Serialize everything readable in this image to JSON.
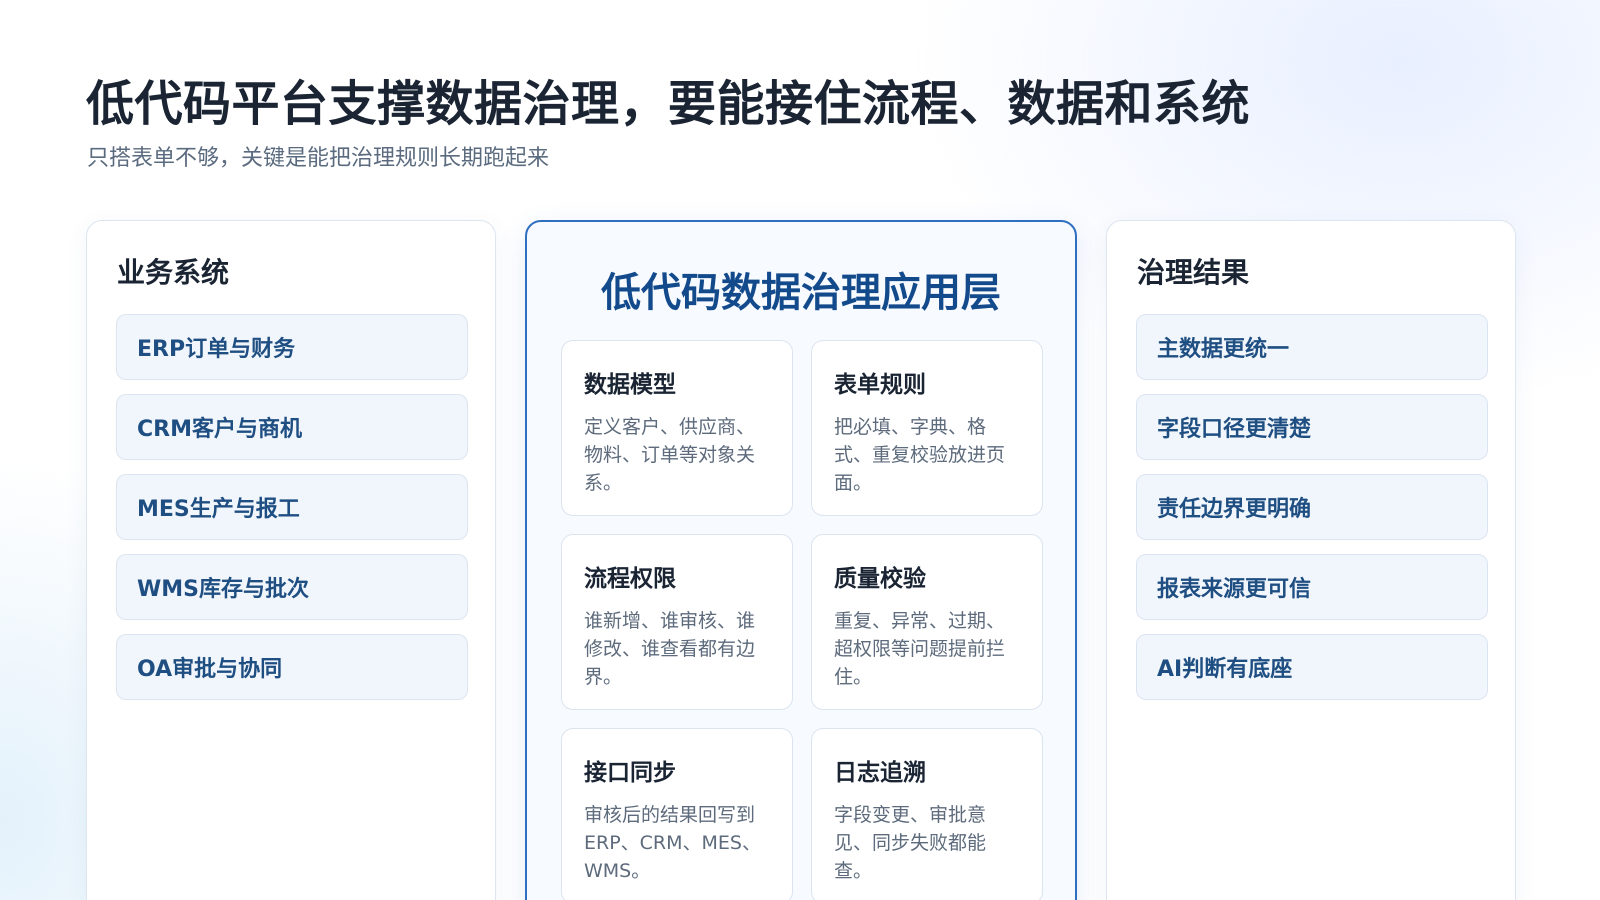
{
  "header": {
    "title": "低代码平台支撑数据治理，要能接住流程、数据和系统",
    "subtitle": "只搭表单不够，关键是能把治理规则长期跑起来"
  },
  "left_panel": {
    "heading": "业务系统",
    "items": [
      {
        "label": "ERP订单与财务"
      },
      {
        "label": "CRM客户与商机"
      },
      {
        "label": "MES生产与报工"
      },
      {
        "label": "WMS库存与批次"
      },
      {
        "label": "OA审批与协同"
      }
    ]
  },
  "center_panel": {
    "heading": "低代码数据治理应用层",
    "cards": [
      {
        "title": "数据模型",
        "desc": "定义客户、供应商、物料、订单等对象关系。"
      },
      {
        "title": "表单规则",
        "desc": "把必填、字典、格式、重复校验放进页面。"
      },
      {
        "title": "流程权限",
        "desc": "谁新增、谁审核、谁修改、谁查看都有边界。"
      },
      {
        "title": "质量校验",
        "desc": "重复、异常、过期、超权限等问题提前拦住。"
      },
      {
        "title": "接口同步",
        "desc": "审核后的结果回写到ERP、CRM、MES、WMS。"
      },
      {
        "title": "日志追溯",
        "desc": "字段变更、审批意见、同步失败都能查。"
      }
    ]
  },
  "right_panel": {
    "heading": "治理结果",
    "items": [
      {
        "label": "主数据更统一"
      },
      {
        "label": "字段口径更清楚"
      },
      {
        "label": "责任边界更明确"
      },
      {
        "label": "报表来源更可信"
      },
      {
        "label": "AI判断有底座"
      }
    ]
  },
  "colors": {
    "accent": "#2f6fc2",
    "heading_dark": "#1a2433",
    "item_text": "#1f4f82",
    "item_bg": "#f1f6fc"
  }
}
